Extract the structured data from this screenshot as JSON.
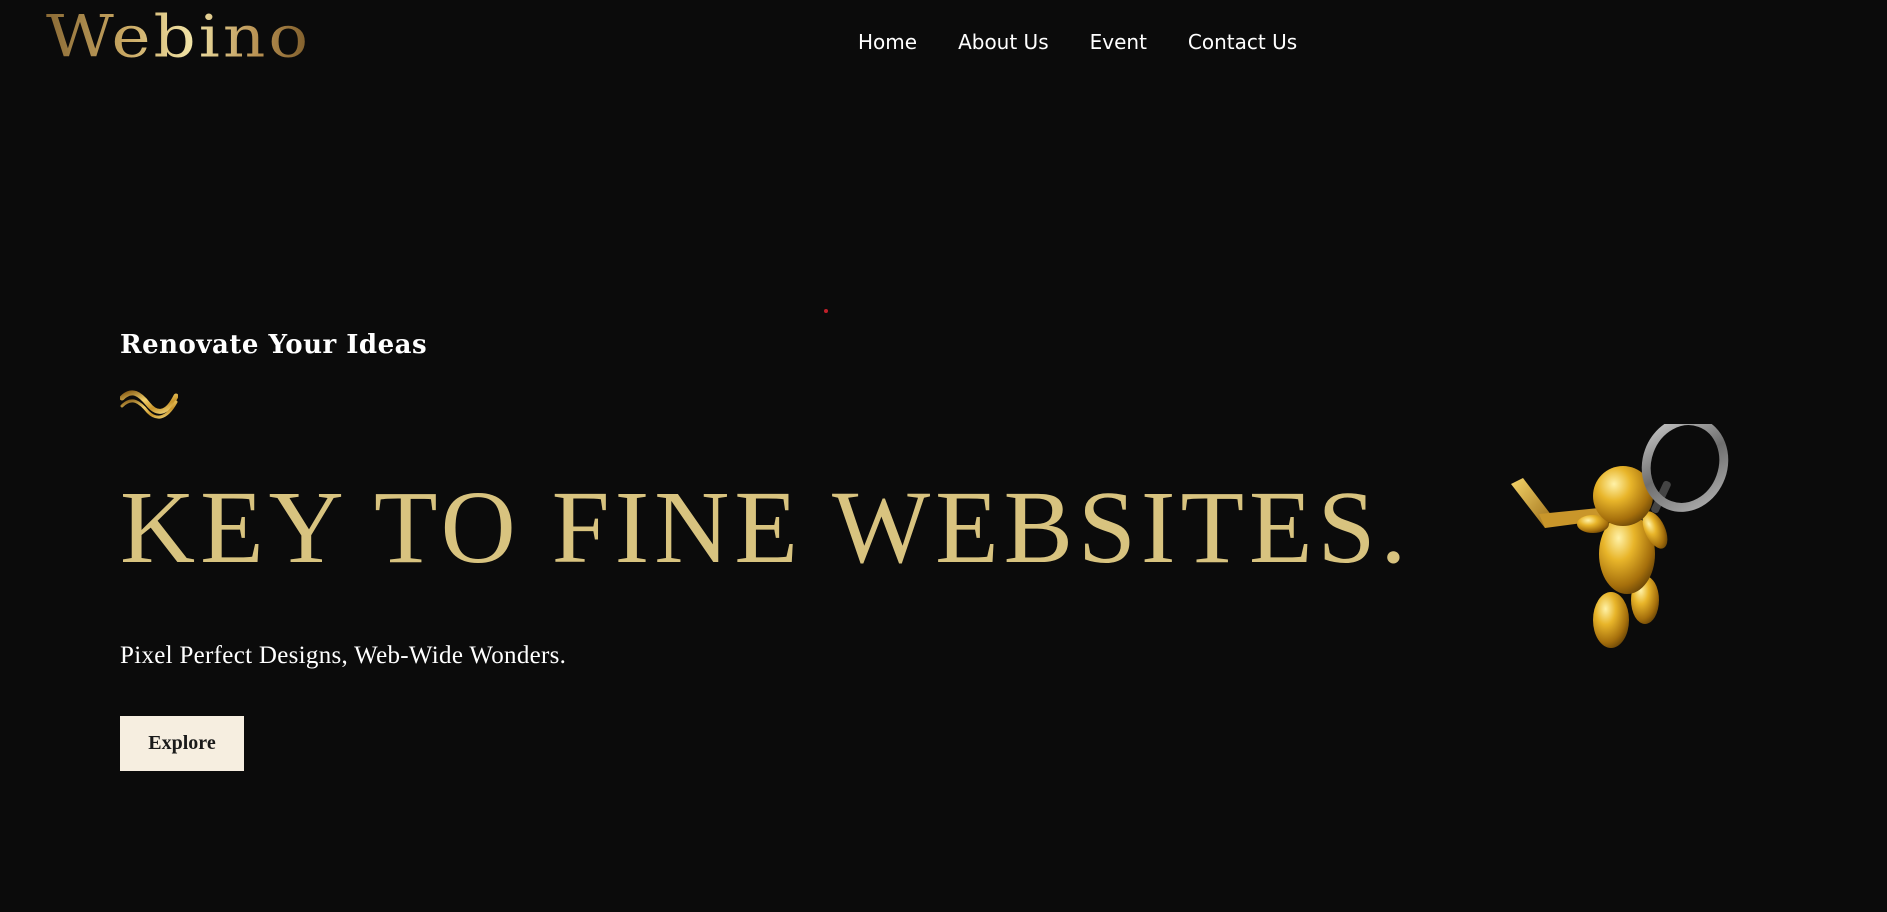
{
  "brand": {
    "logo_text": "Webino"
  },
  "nav": {
    "items": [
      {
        "label": "Home"
      },
      {
        "label": "About Us"
      },
      {
        "label": "Event"
      },
      {
        "label": "Contact Us"
      }
    ]
  },
  "hero": {
    "eyebrow": "Renovate Your Ideas",
    "headline": "KEY TO FINE WEBSITES.",
    "tagline": "Pixel Perfect Designs, Web-Wide Wonders.",
    "cta_label": "Explore",
    "decoration_icon": "gold-wave-icon",
    "illustration": "gold-figure-magnifier-laptop"
  },
  "colors": {
    "background": "#0b0b0b",
    "accent_gold": "#d8c37f",
    "button_bg": "#f6eee0",
    "text": "#ffffff"
  }
}
